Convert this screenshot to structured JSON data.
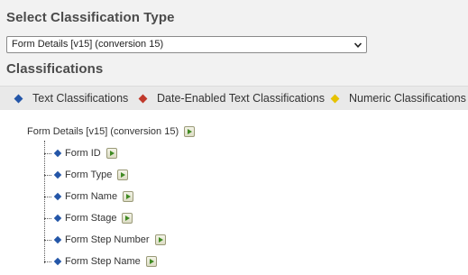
{
  "headings": {
    "select_type": "Select Classification Type",
    "classifications": "Classifications"
  },
  "select": {
    "value": "Form Details [v15] (conversion 15)"
  },
  "legend": {
    "text": "Text Classifications",
    "date": "Date-Enabled Text Classifications",
    "numeric": "Numeric Classifications"
  },
  "colors": {
    "text": "#2456a8",
    "date": "#c0392b",
    "numeric": "#e6c200"
  },
  "tree": {
    "root": "Form Details [v15] (conversion 15)",
    "children": [
      "Form ID",
      "Form Type",
      "Form Name",
      "Form Stage",
      "Form Step Number",
      "Form Step Name"
    ]
  }
}
